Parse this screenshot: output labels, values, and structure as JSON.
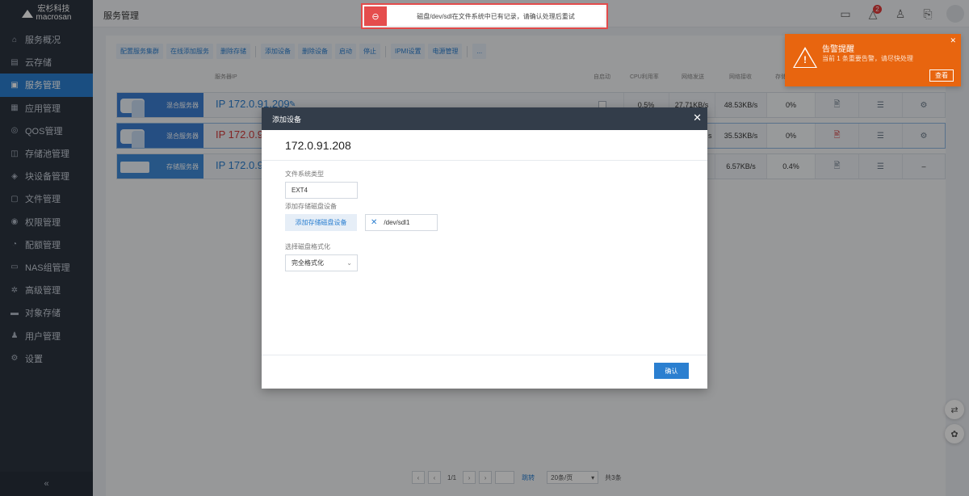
{
  "brand": {
    "logo_top": "宏杉科技",
    "logo_bottom": "macrosan"
  },
  "sidebar": {
    "items": [
      {
        "label": "服务概况",
        "icon": "home-icon"
      },
      {
        "label": "云存储",
        "icon": "building-icon"
      },
      {
        "label": "服务管理",
        "icon": "server-icon",
        "active": true
      },
      {
        "label": "应用管理",
        "icon": "apps-icon"
      },
      {
        "label": "QOS管理",
        "icon": "qos-icon"
      },
      {
        "label": "存储池管理",
        "icon": "storage-pool-icon"
      },
      {
        "label": "块设备管理",
        "icon": "block-device-icon"
      },
      {
        "label": "文件管理",
        "icon": "file-icon"
      },
      {
        "label": "权限管理",
        "icon": "permission-icon"
      },
      {
        "label": "配额管理",
        "icon": "quota-icon"
      },
      {
        "label": "NAS组管理",
        "icon": "nas-icon"
      },
      {
        "label": "高级管理",
        "icon": "advanced-icon"
      },
      {
        "label": "对象存储",
        "icon": "object-storage-icon"
      },
      {
        "label": "用户管理",
        "icon": "user-icon"
      },
      {
        "label": "设置",
        "icon": "gear-icon"
      }
    ],
    "collapse_label": "«"
  },
  "topbar": {
    "title": "服务管理",
    "alarm_count": "2"
  },
  "error_toast": {
    "text": "磁盘/dev/sdl在文件系统中已有记录，请确认处理后重试"
  },
  "toolbar": {
    "buttons": [
      "配置服务集群",
      "在线添加服务",
      "删除存储",
      "添加设备",
      "删除设备",
      "启动",
      "停止",
      "IPMI设置",
      "电源管理",
      "..."
    ]
  },
  "table": {
    "headers": {
      "ip": "服务器IP",
      "autostart": "自启动",
      "cpu": "CPU利用率",
      "net_send": "网络发送",
      "net_recv": "网络接收",
      "storage": "存储"
    },
    "rows": [
      {
        "type": "混合服务器",
        "ip": "IP 172.0.91.209",
        "cpu": "0.5%",
        "send": "27.71KB/s",
        "recv": "48.53KB/s",
        "usage": "0%",
        "error": false
      },
      {
        "type": "混合服务器",
        "ip": "IP 172.0.91",
        "cpu": "",
        "send": "s",
        "recv": "35.53KB/s",
        "usage": "0%",
        "error": true
      },
      {
        "type": "存储服务器",
        "ip": "IP 172.0.91",
        "cpu": "",
        "send": "",
        "recv": "6.57KB/s",
        "usage": "0.4%",
        "error": false,
        "dash": "–"
      }
    ]
  },
  "alarm": {
    "title": "告警提醒",
    "message": "当前 1 条重要告警，请尽快处理",
    "view": "查看"
  },
  "modal": {
    "title": "添加设备",
    "subtitle": "172.0.91.208",
    "fs_type_label": "文件系统类型",
    "fs_type_value": "EXT4",
    "add_disk_label": "添加存储磁盘设备",
    "add_disk_button": "添加存储磁盘设备",
    "device": "/dev/sdl1",
    "format_label": "选择磁盘格式化",
    "format_value": "完全格式化",
    "confirm": "确认"
  },
  "pagination": {
    "page": "1/1",
    "jump": "跳转",
    "page_size": "20条/页",
    "total": "共3条"
  }
}
